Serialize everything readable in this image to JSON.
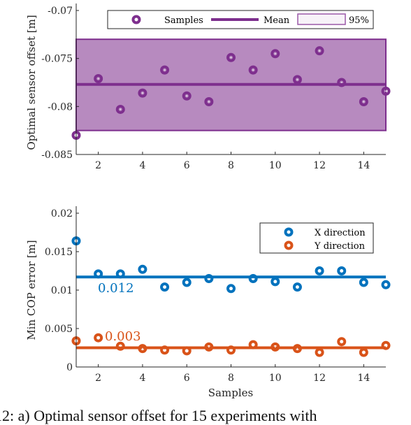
{
  "chart_data": [
    {
      "type": "scatter",
      "id": "top",
      "title": "",
      "xlabel": "",
      "ylabel": "Optimal sensor offset [m]",
      "xlim": [
        1,
        15
      ],
      "ylim": [
        -0.085,
        -0.07
      ],
      "xticks": [
        2,
        4,
        6,
        8,
        10,
        12,
        14
      ],
      "xtick_labels": [
        "2",
        "4",
        "6",
        "8",
        "10",
        "12",
        "14"
      ],
      "yticks": [
        -0.085,
        -0.08,
        -0.075,
        -0.07
      ],
      "ytick_labels": [
        "-0.085",
        "-0.08",
        "-0.075",
        "-0.07"
      ],
      "x": [
        1,
        2,
        3,
        4,
        5,
        6,
        7,
        8,
        9,
        10,
        11,
        12,
        13,
        14,
        15
      ],
      "series": [
        {
          "name": "Samples",
          "color": "#7E2F8E",
          "values": [
            -0.083,
            -0.0771,
            -0.0803,
            -0.0786,
            -0.0762,
            -0.0789,
            -0.0795,
            -0.0749,
            -0.0762,
            -0.0745,
            -0.0772,
            -0.0742,
            -0.0775,
            -0.0795,
            -0.0784
          ]
        }
      ],
      "mean": {
        "name": "Mean",
        "value": -0.0777,
        "color": "#7E2F8E"
      },
      "band": {
        "name": "95%",
        "lower": -0.0825,
        "upper": -0.073,
        "fill": "#B78ABF",
        "edge": "#7E2F8E"
      },
      "legend": {
        "position": "top",
        "orientation": "horizontal",
        "entries": [
          "Samples",
          "Mean",
          "95%"
        ]
      },
      "grid": false
    },
    {
      "type": "scatter",
      "id": "bottom",
      "title": "",
      "xlabel": "Samples",
      "ylabel": "Min COP error [m]",
      "xlim": [
        1,
        15
      ],
      "ylim": [
        0,
        0.02
      ],
      "xticks": [
        2,
        4,
        6,
        8,
        10,
        12,
        14
      ],
      "xtick_labels": [
        "2",
        "4",
        "6",
        "8",
        "10",
        "12",
        "14"
      ],
      "yticks": [
        0,
        0.005,
        0.01,
        0.015,
        0.02
      ],
      "ytick_labels": [
        "0",
        "0.005",
        "0.01",
        "0.015",
        "0.02"
      ],
      "x": [
        1,
        2,
        3,
        4,
        5,
        6,
        7,
        8,
        9,
        10,
        11,
        12,
        13,
        14,
        15
      ],
      "series": [
        {
          "name": "X direction",
          "color": "#0072BD",
          "mean": 0.0117,
          "annotation": "0.012",
          "values": [
            0.0164,
            0.0121,
            0.0121,
            0.0127,
            0.0104,
            0.011,
            0.0115,
            0.0102,
            0.0115,
            0.0111,
            0.0104,
            0.0125,
            0.0125,
            0.011,
            0.0107
          ]
        },
        {
          "name": "Y direction",
          "color": "#D95319",
          "mean": 0.0025,
          "annotation": "0.003",
          "values": [
            0.0034,
            0.0038,
            0.0027,
            0.0024,
            0.0022,
            0.0021,
            0.0026,
            0.0022,
            0.0029,
            0.0026,
            0.0024,
            0.0019,
            0.0033,
            0.0019,
            0.0028
          ]
        }
      ],
      "legend": {
        "position": "top-right",
        "entries": [
          "X direction",
          "Y direction"
        ]
      },
      "grid": false
    }
  ],
  "caption": "12: a) Optimal sensor offset for 15 experiments with"
}
